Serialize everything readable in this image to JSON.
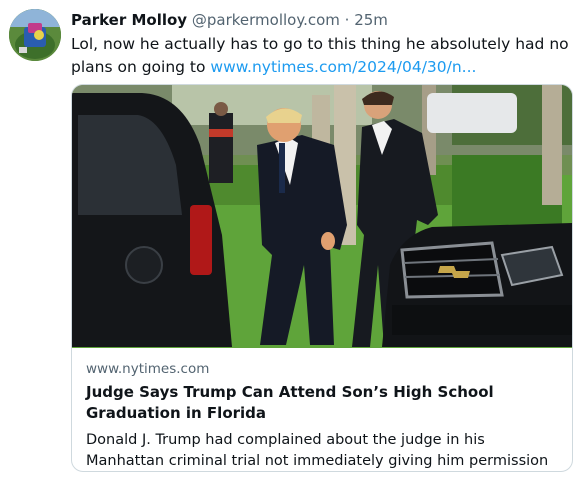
{
  "post": {
    "author_name": "Parker Molloy",
    "handle": "@parkermolloy.com",
    "separator": "·",
    "timestamp": "25m",
    "text": "Lol, now he actually has to go to this thing he absolutely had no plans on going to ",
    "link_text": "www.nytimes.com/2024/04/30/n..."
  },
  "card": {
    "domain": "www.nytimes.com",
    "title": "Judge Says Trump Can Attend Son’s High School Graduation in Florida",
    "description": "Donald J. Trump had complained about the judge in his Manhattan criminal trial not immediately giving him permission to be away ..."
  },
  "colors": {
    "link": "#1d9bf0",
    "secondary_text": "#536471",
    "border": "#cfd9de"
  },
  "icons": {
    "avatar": "avatar-image"
  }
}
